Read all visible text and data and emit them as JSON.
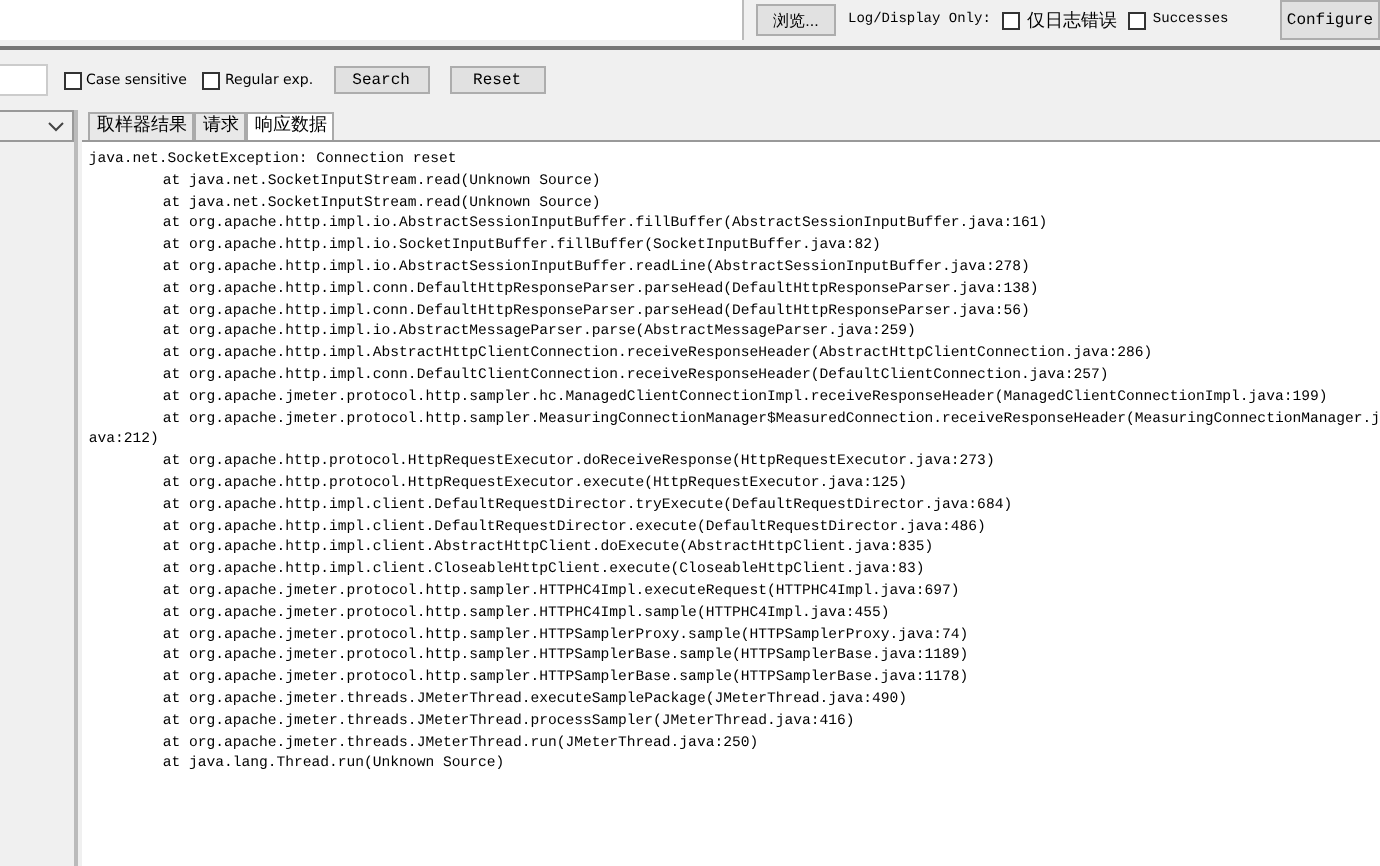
{
  "top_bar": {
    "browse_button": "浏览...",
    "log_label": "Log/Display Only:",
    "checkboxes": [
      {
        "label": "仅日志错误",
        "checked": false
      },
      {
        "label": "Successes",
        "checked": false
      }
    ],
    "configure_button": "Configure"
  },
  "search_bar": {
    "checkboxes": [
      {
        "label": "Case sensitive",
        "checked": false
      },
      {
        "label": "Regular exp.",
        "checked": false
      }
    ],
    "buttons": [
      "Search",
      "Reset"
    ]
  },
  "tabs": [
    {
      "label": "取样器结果",
      "selected": false
    },
    {
      "label": "请求",
      "selected": false
    },
    {
      "label": "响应数据",
      "selected": true
    }
  ],
  "response_lines": [
    {
      "kind": "head",
      "text": "java.net.SocketException: Connection reset"
    },
    {
      "kind": "frame",
      "text": "at java.net.SocketInputStream.read(Unknown Source)"
    },
    {
      "kind": "frame",
      "text": "at java.net.SocketInputStream.read(Unknown Source)"
    },
    {
      "kind": "frame",
      "text": "at org.apache.http.impl.io.AbstractSessionInputBuffer.fillBuffer(AbstractSessionInputBuffer.java:161)"
    },
    {
      "kind": "frame",
      "text": "at org.apache.http.impl.io.SocketInputBuffer.fillBuffer(SocketInputBuffer.java:82)"
    },
    {
      "kind": "frame",
      "text": "at org.apache.http.impl.io.AbstractSessionInputBuffer.readLine(AbstractSessionInputBuffer.java:278)"
    },
    {
      "kind": "frame",
      "text": "at org.apache.http.impl.conn.DefaultHttpResponseParser.parseHead(DefaultHttpResponseParser.java:138)"
    },
    {
      "kind": "frame",
      "text": "at org.apache.http.impl.conn.DefaultHttpResponseParser.parseHead(DefaultHttpResponseParser.java:56)"
    },
    {
      "kind": "frame",
      "text": "at org.apache.http.impl.io.AbstractMessageParser.parse(AbstractMessageParser.java:259)"
    },
    {
      "kind": "frame",
      "text": "at org.apache.http.impl.AbstractHttpClientConnection.receiveResponseHeader(AbstractHttpClientConnection.java:286)"
    },
    {
      "kind": "frame",
      "text": "at org.apache.http.impl.conn.DefaultClientConnection.receiveResponseHeader(DefaultClientConnection.java:257)"
    },
    {
      "kind": "frame",
      "text": "at org.apache.jmeter.protocol.http.sampler.hc.ManagedClientConnectionImpl.receiveResponseHeader(ManagedClientConnectionImpl.java:199)"
    },
    {
      "kind": "frame",
      "text": "at org.apache.jmeter.protocol.http.sampler.MeasuringConnectionManager$MeasuredConnection.receiveResponseHeader(MeasuringConnectionManager.j"
    },
    {
      "kind": "wrap",
      "text": "ava:212)"
    },
    {
      "kind": "frame",
      "text": "at org.apache.http.protocol.HttpRequestExecutor.doReceiveResponse(HttpRequestExecutor.java:273)"
    },
    {
      "kind": "frame",
      "text": "at org.apache.http.protocol.HttpRequestExecutor.execute(HttpRequestExecutor.java:125)"
    },
    {
      "kind": "frame",
      "text": "at org.apache.http.impl.client.DefaultRequestDirector.tryExecute(DefaultRequestDirector.java:684)"
    },
    {
      "kind": "frame",
      "text": "at org.apache.http.impl.client.DefaultRequestDirector.execute(DefaultRequestDirector.java:486)"
    },
    {
      "kind": "frame",
      "text": "at org.apache.http.impl.client.AbstractHttpClient.doExecute(AbstractHttpClient.java:835)"
    },
    {
      "kind": "frame",
      "text": "at org.apache.http.impl.client.CloseableHttpClient.execute(CloseableHttpClient.java:83)"
    },
    {
      "kind": "frame",
      "text": "at org.apache.jmeter.protocol.http.sampler.HTTPHC4Impl.executeRequest(HTTPHC4Impl.java:697)"
    },
    {
      "kind": "frame",
      "text": "at org.apache.jmeter.protocol.http.sampler.HTTPHC4Impl.sample(HTTPHC4Impl.java:455)"
    },
    {
      "kind": "frame",
      "text": "at org.apache.jmeter.protocol.http.sampler.HTTPSamplerProxy.sample(HTTPSamplerProxy.java:74)"
    },
    {
      "kind": "frame",
      "text": "at org.apache.jmeter.protocol.http.sampler.HTTPSamplerBase.sample(HTTPSamplerBase.java:1189)"
    },
    {
      "kind": "frame",
      "text": "at org.apache.jmeter.protocol.http.sampler.HTTPSamplerBase.sample(HTTPSamplerBase.java:1178)"
    },
    {
      "kind": "frame",
      "text": "at org.apache.jmeter.threads.JMeterThread.executeSamplePackage(JMeterThread.java:490)"
    },
    {
      "kind": "frame",
      "text": "at org.apache.jmeter.threads.JMeterThread.processSampler(JMeterThread.java:416)"
    },
    {
      "kind": "frame",
      "text": "at org.apache.jmeter.threads.JMeterThread.run(JMeterThread.java:250)"
    },
    {
      "kind": "frame",
      "text": "at java.lang.Thread.run(Unknown Source)"
    }
  ]
}
